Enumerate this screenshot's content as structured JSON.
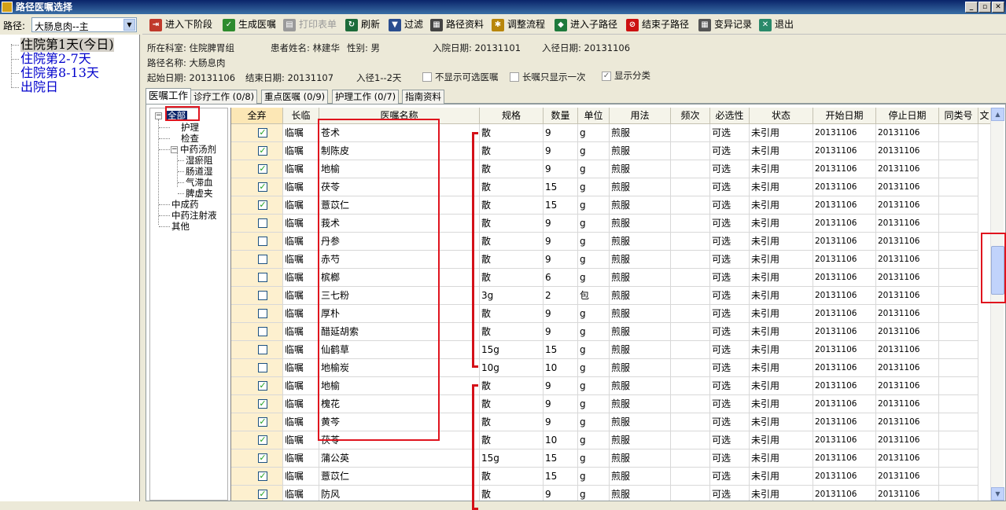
{
  "window": {
    "title": "路径医嘱选择",
    "controls": [
      "_",
      "▫",
      "✕"
    ]
  },
  "path_selector": {
    "label": "路径:",
    "value": "大肠息肉--主",
    "days": [
      {
        "label": "住院第1天(今日)",
        "selected": true
      },
      {
        "label": "住院第2-7天",
        "selected": false
      },
      {
        "label": "住院第8-13天",
        "selected": false
      },
      {
        "label": "出院日",
        "selected": false
      }
    ]
  },
  "toolbar": [
    {
      "name": "next-stage-button",
      "label": "进入下阶段",
      "icon": "enter-icon",
      "color": "#c0392b",
      "enabled": true
    },
    {
      "name": "generate-order-button",
      "label": "生成医嘱",
      "icon": "check-icon",
      "color": "#2e8b2e",
      "enabled": true
    },
    {
      "name": "print-form-button",
      "label": "打印表单",
      "icon": "printer-icon",
      "color": "#9a9a9a",
      "enabled": false
    },
    {
      "name": "refresh-button",
      "label": "刷新",
      "icon": "refresh-icon",
      "color": "#1d6b3a",
      "enabled": true
    },
    {
      "name": "filter-button",
      "label": "过滤",
      "icon": "funnel-icon",
      "color": "#2a4d8f",
      "enabled": true
    },
    {
      "name": "path-data-button",
      "label": "路径资料",
      "icon": "document-icon",
      "color": "#444444",
      "enabled": true
    },
    {
      "name": "adjust-flow-button",
      "label": "调整流程",
      "icon": "flow-icon",
      "color": "#b8860b",
      "enabled": true
    },
    {
      "name": "enter-subpath-button",
      "label": "进入子路径",
      "icon": "footprints-icon",
      "color": "#1e7a3c",
      "enabled": true
    },
    {
      "name": "end-subpath-button",
      "label": "结束子路径",
      "icon": "stop-icon",
      "color": "#cc1111",
      "enabled": true
    },
    {
      "name": "variation-record-button",
      "label": "变异记录",
      "icon": "calculator-icon",
      "color": "#555555",
      "enabled": true
    },
    {
      "name": "exit-button",
      "label": "退出",
      "icon": "exit-icon",
      "color": "#2a8a6a",
      "enabled": true
    }
  ],
  "patient": {
    "dept": "所在科室: 住院脾胃组",
    "name": "患者姓名: 林建华",
    "sex": "性别:  男",
    "admit_date": "入院日期: 20131101",
    "path_entry_date": "入径日期: 20131106",
    "path_name": "路径名称: 大肠息肉",
    "start_date": "起始日期: 20131106",
    "end_date": "结束日期: 20131107",
    "stage": "入径1--2天"
  },
  "options": [
    {
      "label": "不显示可选医嘱",
      "checked": false
    },
    {
      "label": "长嘱只显示一次",
      "checked": false
    },
    {
      "label": "显示分类",
      "checked": true
    }
  ],
  "tabs": [
    {
      "label": "医嘱工作",
      "active": true
    },
    {
      "label": "诊疗工作 (0/8)",
      "active": false
    },
    {
      "label": "重点医嘱 (0/9)",
      "active": false
    },
    {
      "label": "护理工作 (0/7)",
      "active": false
    },
    {
      "label": "指南资料",
      "active": false
    }
  ],
  "tree": {
    "root": "全部",
    "nodes": [
      {
        "label": "护理",
        "level": 1
      },
      {
        "label": "检查",
        "level": 1
      },
      {
        "label": "中药汤剂",
        "level": 1,
        "expanded": true
      },
      {
        "label": "湿瘀阻",
        "level": 2
      },
      {
        "label": "肠道湿",
        "level": 2
      },
      {
        "label": "气滞血",
        "level": 2
      },
      {
        "label": "脾虚夹",
        "level": 2
      },
      {
        "label": "中成药",
        "level": 1
      },
      {
        "label": "中药注射液",
        "level": 1
      },
      {
        "label": "其他",
        "level": 1
      }
    ]
  },
  "grid": {
    "columns": [
      "全弃",
      "长临",
      "医嘱名称",
      "规格",
      "数量",
      "单位",
      "用法",
      "频次",
      "必选性",
      "状态",
      "开始日期",
      "停止日期",
      "同类号",
      "文"
    ],
    "rows": [
      {
        "checked": true,
        "type": "临嘱",
        "name": "苍术",
        "spec": "散",
        "qty": "9",
        "unit": "g",
        "usage": "煎服",
        "freq": "",
        "req": "可选",
        "status": "未引用",
        "start": "20131106",
        "stop": "20131106"
      },
      {
        "checked": true,
        "type": "临嘱",
        "name": "制陈皮",
        "spec": "散",
        "qty": "9",
        "unit": "g",
        "usage": "煎服",
        "freq": "",
        "req": "可选",
        "status": "未引用",
        "start": "20131106",
        "stop": "20131106"
      },
      {
        "checked": true,
        "type": "临嘱",
        "name": "地榆",
        "spec": "散",
        "qty": "9",
        "unit": "g",
        "usage": "煎服",
        "freq": "",
        "req": "可选",
        "status": "未引用",
        "start": "20131106",
        "stop": "20131106"
      },
      {
        "checked": true,
        "type": "临嘱",
        "name": "茯苓",
        "spec": "散",
        "qty": "15",
        "unit": "g",
        "usage": "煎服",
        "freq": "",
        "req": "可选",
        "status": "未引用",
        "start": "20131106",
        "stop": "20131106"
      },
      {
        "checked": true,
        "type": "临嘱",
        "name": "薏苡仁",
        "spec": "散",
        "qty": "15",
        "unit": "g",
        "usage": "煎服",
        "freq": "",
        "req": "可选",
        "status": "未引用",
        "start": "20131106",
        "stop": "20131106"
      },
      {
        "checked": false,
        "type": "临嘱",
        "name": "莪术",
        "spec": "散",
        "qty": "9",
        "unit": "g",
        "usage": "煎服",
        "freq": "",
        "req": "可选",
        "status": "未引用",
        "start": "20131106",
        "stop": "20131106"
      },
      {
        "checked": false,
        "type": "临嘱",
        "name": "丹参",
        "spec": "散",
        "qty": "9",
        "unit": "g",
        "usage": "煎服",
        "freq": "",
        "req": "可选",
        "status": "未引用",
        "start": "20131106",
        "stop": "20131106"
      },
      {
        "checked": false,
        "type": "临嘱",
        "name": "赤芍",
        "spec": "散",
        "qty": "9",
        "unit": "g",
        "usage": "煎服",
        "freq": "",
        "req": "可选",
        "status": "未引用",
        "start": "20131106",
        "stop": "20131106"
      },
      {
        "checked": false,
        "type": "临嘱",
        "name": "槟榔",
        "spec": "散",
        "qty": "6",
        "unit": "g",
        "usage": "煎服",
        "freq": "",
        "req": "可选",
        "status": "未引用",
        "start": "20131106",
        "stop": "20131106"
      },
      {
        "checked": false,
        "type": "临嘱",
        "name": "三七粉",
        "spec": "3g",
        "qty": "2",
        "unit": "包",
        "usage": "煎服",
        "freq": "",
        "req": "可选",
        "status": "未引用",
        "start": "20131106",
        "stop": "20131106"
      },
      {
        "checked": false,
        "type": "临嘱",
        "name": "厚朴",
        "spec": "散",
        "qty": "9",
        "unit": "g",
        "usage": "煎服",
        "freq": "",
        "req": "可选",
        "status": "未引用",
        "start": "20131106",
        "stop": "20131106"
      },
      {
        "checked": false,
        "type": "临嘱",
        "name": "醋延胡索",
        "spec": "散",
        "qty": "9",
        "unit": "g",
        "usage": "煎服",
        "freq": "",
        "req": "可选",
        "status": "未引用",
        "start": "20131106",
        "stop": "20131106"
      },
      {
        "checked": false,
        "type": "临嘱",
        "name": "仙鹤草",
        "spec": "15g",
        "qty": "15",
        "unit": "g",
        "usage": "煎服",
        "freq": "",
        "req": "可选",
        "status": "未引用",
        "start": "20131106",
        "stop": "20131106"
      },
      {
        "checked": false,
        "type": "临嘱",
        "name": "地榆炭",
        "spec": "10g",
        "qty": "10",
        "unit": "g",
        "usage": "煎服",
        "freq": "",
        "req": "可选",
        "status": "未引用",
        "start": "20131106",
        "stop": "20131106"
      },
      {
        "checked": true,
        "type": "临嘱",
        "name": "地榆",
        "spec": "散",
        "qty": "9",
        "unit": "g",
        "usage": "煎服",
        "freq": "",
        "req": "可选",
        "status": "未引用",
        "start": "20131106",
        "stop": "20131106"
      },
      {
        "checked": true,
        "type": "临嘱",
        "name": "槐花",
        "spec": "散",
        "qty": "9",
        "unit": "g",
        "usage": "煎服",
        "freq": "",
        "req": "可选",
        "status": "未引用",
        "start": "20131106",
        "stop": "20131106"
      },
      {
        "checked": true,
        "type": "临嘱",
        "name": "黄芩",
        "spec": "散",
        "qty": "9",
        "unit": "g",
        "usage": "煎服",
        "freq": "",
        "req": "可选",
        "status": "未引用",
        "start": "20131106",
        "stop": "20131106"
      },
      {
        "checked": true,
        "type": "临嘱",
        "name": "茯苓",
        "spec": "散",
        "qty": "10",
        "unit": "g",
        "usage": "煎服",
        "freq": "",
        "req": "可选",
        "status": "未引用",
        "start": "20131106",
        "stop": "20131106"
      },
      {
        "checked": true,
        "type": "临嘱",
        "name": "蒲公英",
        "spec": "15g",
        "qty": "15",
        "unit": "g",
        "usage": "煎服",
        "freq": "",
        "req": "可选",
        "status": "未引用",
        "start": "20131106",
        "stop": "20131106"
      },
      {
        "checked": true,
        "type": "临嘱",
        "name": "薏苡仁",
        "spec": "散",
        "qty": "15",
        "unit": "g",
        "usage": "煎服",
        "freq": "",
        "req": "可选",
        "status": "未引用",
        "start": "20131106",
        "stop": "20131106"
      },
      {
        "checked": true,
        "type": "临嘱",
        "name": "防风",
        "spec": "散",
        "qty": "9",
        "unit": "g",
        "usage": "煎服",
        "freq": "",
        "req": "可选",
        "status": "未引用",
        "start": "20131106",
        "stop": "20131106"
      }
    ]
  },
  "colors": {
    "titlebar": "#0a246a",
    "day_link": "#0000cc",
    "annotation_red": "#e0141e",
    "check_column_bg": "#fdf0cf"
  }
}
